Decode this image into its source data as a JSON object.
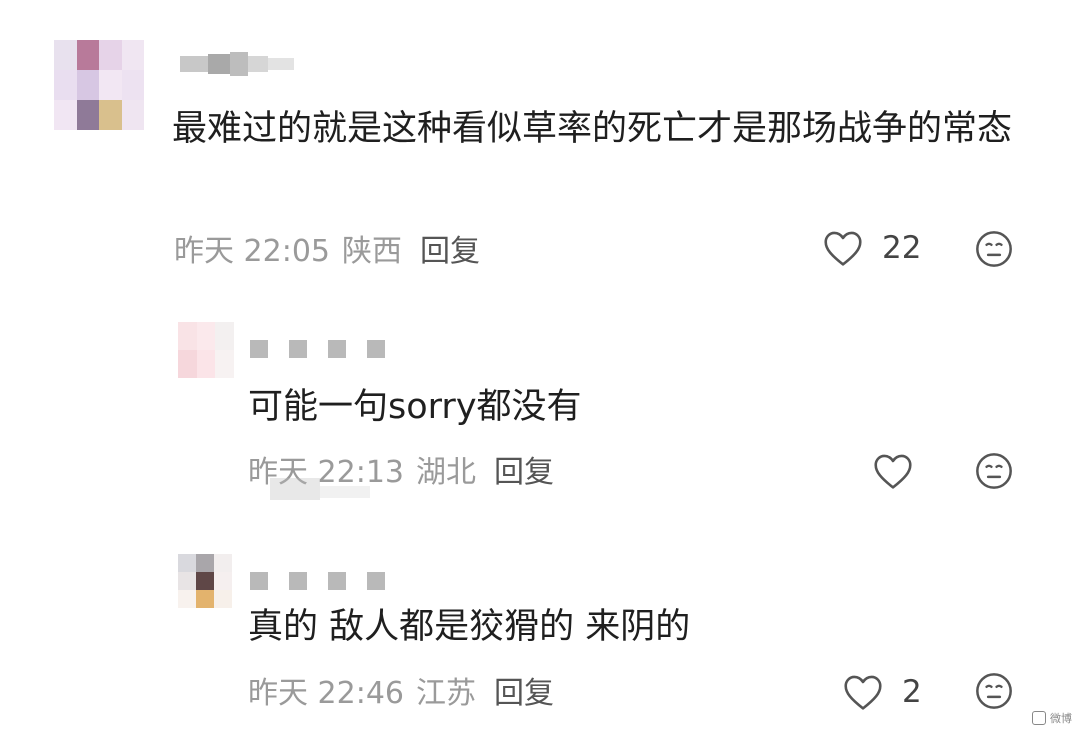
{
  "comments": [
    {
      "content": "最难过的就是这种看似草率的死亡才是那场战争的常态",
      "time": "昨天 22:05",
      "location": "陕西",
      "reply_label": "回复",
      "like_count": "22",
      "avatar_colors": [
        "#e8e1ee",
        "#b87a9a",
        "#e6d3e8",
        "#f0e6f2",
        "#e9def0",
        "#d7c7e3",
        "#f2e7f3",
        "#ede2f1",
        "#f1e6f3",
        "#8f7a98",
        "#d9c08d",
        "#efe5f1"
      ]
    },
    {
      "content": "可能一句sorry都没有",
      "time": "昨天 22:13",
      "location": "湖北",
      "reply_label": "回复",
      "like_count": "",
      "avatar_colors": [
        "#f9e3e6",
        "#fbe9ec",
        "#f3f0f0",
        "#f6d7dc",
        "#fbe4e8",
        "#f7f2f2"
      ]
    },
    {
      "content": "真的 敌人都是狡猾的 来阴的",
      "time": "昨天 22:46",
      "location": "江苏",
      "reply_label": "回复",
      "like_count": "2",
      "avatar_colors": [
        "#d9d9de",
        "#a9a6aa",
        "#f2eeee",
        "#e8e4e5",
        "#5f4747",
        "#f5efef",
        "#f8f2ee",
        "#e3b36d",
        "#f7f0ea"
      ]
    }
  ],
  "watermark": {
    "text": "微博"
  },
  "colors": {
    "text_primary": "#1f1f1f",
    "text_meta": "#9a9a9a",
    "icon": "#555555"
  },
  "icons": [
    "heart-outline-icon",
    "smile-neutral-icon"
  ]
}
